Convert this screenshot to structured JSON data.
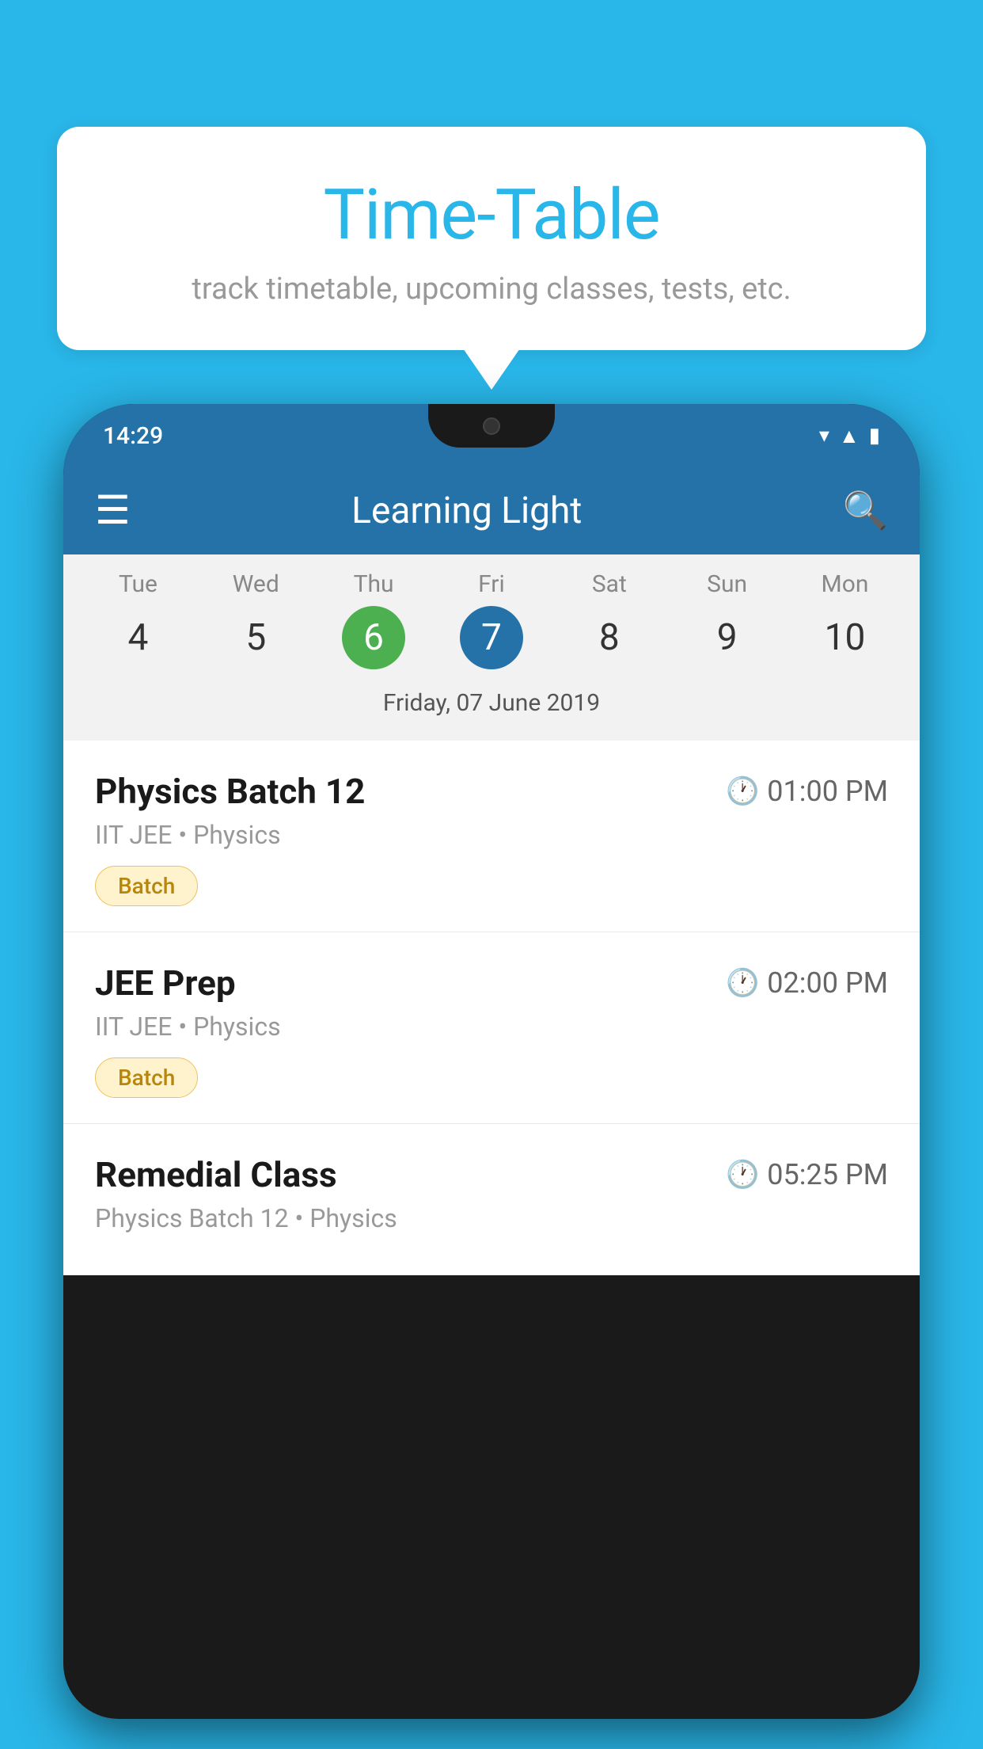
{
  "background": {
    "color": "#29b6e8"
  },
  "speech_bubble": {
    "title": "Time-Table",
    "subtitle": "track timetable, upcoming classes, tests, etc."
  },
  "phone": {
    "status_bar": {
      "time": "14:29"
    },
    "app_bar": {
      "title": "Learning Light"
    },
    "calendar": {
      "days": [
        {
          "name": "Tue",
          "number": "4",
          "state": "normal"
        },
        {
          "name": "Wed",
          "number": "5",
          "state": "normal"
        },
        {
          "name": "Thu",
          "number": "6",
          "state": "today"
        },
        {
          "name": "Fri",
          "number": "7",
          "state": "selected"
        },
        {
          "name": "Sat",
          "number": "8",
          "state": "normal"
        },
        {
          "name": "Sun",
          "number": "9",
          "state": "normal"
        },
        {
          "name": "Mon",
          "number": "10",
          "state": "normal"
        }
      ],
      "selected_date_label": "Friday, 07 June 2019"
    },
    "schedule": [
      {
        "title": "Physics Batch 12",
        "time": "01:00 PM",
        "subtitle": "IIT JEE • Physics",
        "tag": "Batch"
      },
      {
        "title": "JEE Prep",
        "time": "02:00 PM",
        "subtitle": "IIT JEE • Physics",
        "tag": "Batch"
      },
      {
        "title": "Remedial Class",
        "time": "05:25 PM",
        "subtitle": "Physics Batch 12 • Physics",
        "tag": null
      }
    ]
  }
}
